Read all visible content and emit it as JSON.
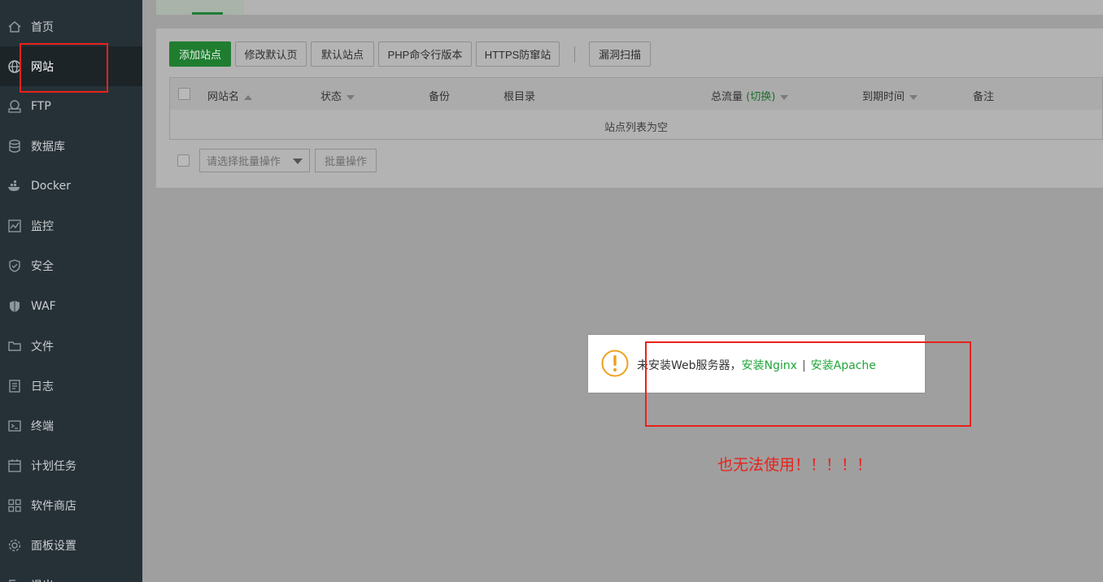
{
  "sidebar": {
    "items": [
      {
        "label": "首页",
        "icon": "home-icon"
      },
      {
        "label": "网站",
        "icon": "globe-icon",
        "active": true
      },
      {
        "label": "FTP",
        "icon": "ftp-icon"
      },
      {
        "label": "数据库",
        "icon": "database-icon"
      },
      {
        "label": "Docker",
        "icon": "docker-icon"
      },
      {
        "label": "监控",
        "icon": "monitor-icon"
      },
      {
        "label": "安全",
        "icon": "shield-icon"
      },
      {
        "label": "WAF",
        "icon": "waf-icon"
      },
      {
        "label": "文件",
        "icon": "folder-icon"
      },
      {
        "label": "日志",
        "icon": "log-icon"
      },
      {
        "label": "终端",
        "icon": "terminal-icon"
      },
      {
        "label": "计划任务",
        "icon": "calendar-icon"
      },
      {
        "label": "软件商店",
        "icon": "apps-icon"
      },
      {
        "label": "面板设置",
        "icon": "gear-icon"
      },
      {
        "label": "退出",
        "icon": "logout-icon"
      }
    ]
  },
  "toolbar": {
    "add_site": "添加站点",
    "modify_default_page": "修改默认页",
    "default_site": "默认站点",
    "php_cli_version": "PHP命令行版本",
    "https_guard": "HTTPS防窜站",
    "vuln_scan": "漏洞扫描"
  },
  "table": {
    "columns": {
      "site_name": "网站名",
      "status": "状态",
      "backup": "备份",
      "root_dir": "根目录",
      "total_traffic": "总流量",
      "traffic_toggle": "(切换)",
      "expire_time": "到期时间",
      "remark": "备注"
    },
    "empty_message": "站点列表为空"
  },
  "batch": {
    "select_placeholder": "请选择批量操作",
    "apply_label": "批量操作"
  },
  "dialog": {
    "message": "未安装Web服务器，",
    "install_nginx": "安装Nginx",
    "separator": "|",
    "install_apache": "安装Apache"
  },
  "annotation": {
    "text": "也无法使用！！！！！"
  },
  "colors": {
    "primary_green": "#20a53a",
    "annotation_red": "#e8221c",
    "warning_orange": "#f0a020"
  }
}
